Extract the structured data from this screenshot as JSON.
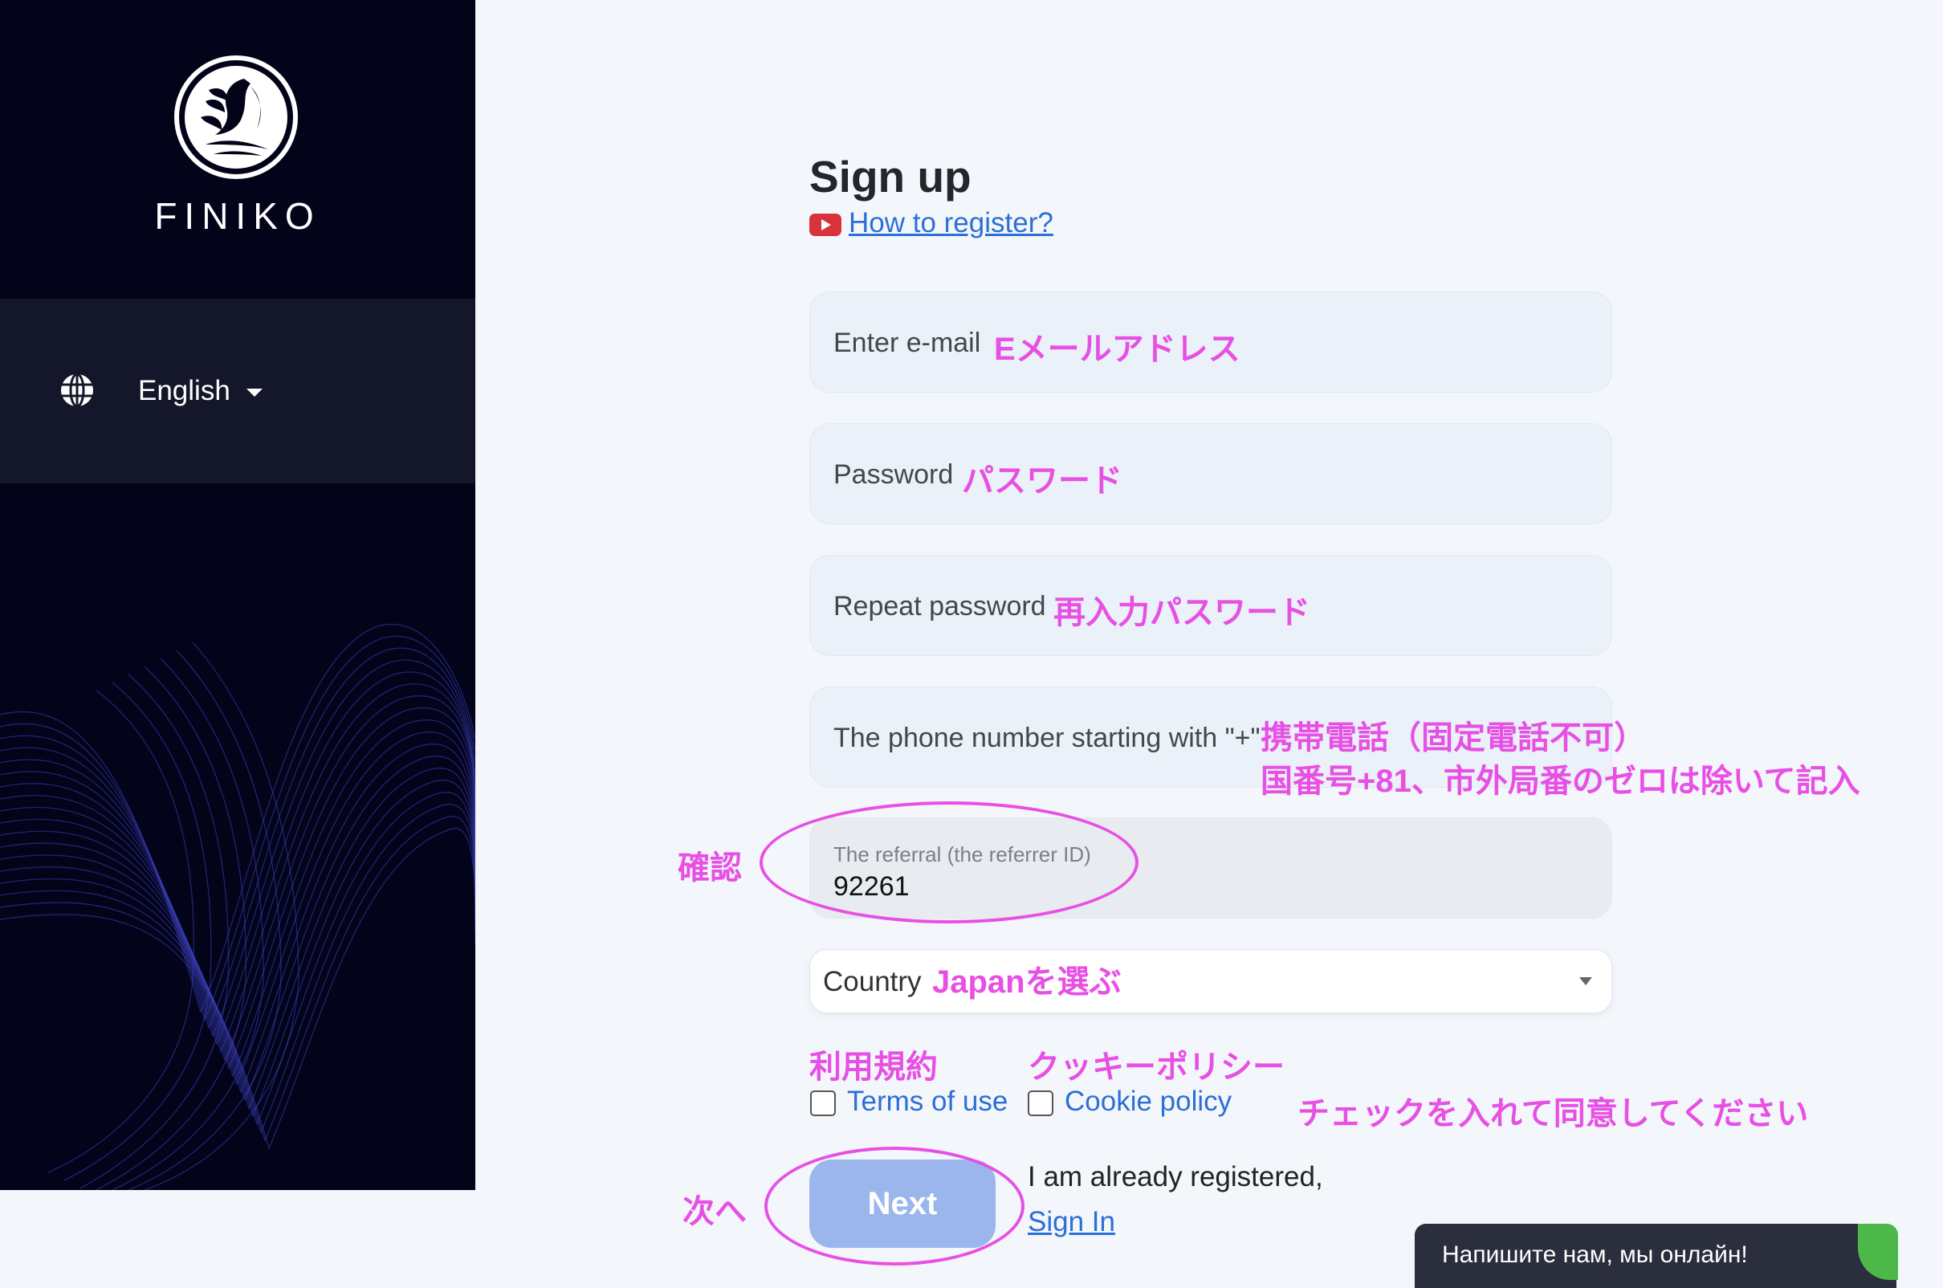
{
  "sidebar": {
    "brand": "FINIKO",
    "logo_icon": "finiko-logo-icon",
    "language": {
      "label": "English",
      "icon": "globe-icon"
    }
  },
  "form": {
    "title": "Sign up",
    "how_to_link": "How to register?",
    "fields": {
      "email": {
        "label": "Enter e-mail",
        "note": "Eメールアドレス"
      },
      "password": {
        "label": "Password",
        "note": "パスワード"
      },
      "repeat_password": {
        "label": "Repeat password",
        "note": "再入力パスワード"
      },
      "phone": {
        "label": "The phone number starting with \"+\"",
        "note_line1": "携帯電話（固定電話不可）",
        "note_line2": "国番号+81、市外局番のゼロは除いて記入"
      },
      "referral": {
        "label": "The referral (the referrer ID)",
        "value": "92261",
        "note": "確認"
      },
      "country": {
        "label": "Country",
        "note": "Japanを選ぶ"
      }
    },
    "agreements": {
      "terms": {
        "label": "Terms of use",
        "note": "利用規約"
      },
      "cookie": {
        "label": "Cookie policy",
        "note": "クッキーポリシー"
      },
      "note": "チェックを入れて同意してください"
    },
    "next_button": {
      "label": "Next",
      "note": "次へ"
    },
    "already_registered": "I am already registered,",
    "sign_in": "Sign In"
  },
  "chat": {
    "text": "Напишите нам, мы онлайн!"
  },
  "colors": {
    "sidebar_bg": "#03031a",
    "lang_band_bg": "#14162a",
    "link": "#2c6fd6",
    "annotation": "#e84fe4",
    "next_button": "#9ab6ec",
    "chat_bg": "#2b2f3d",
    "chat_accent": "#4db84a"
  }
}
